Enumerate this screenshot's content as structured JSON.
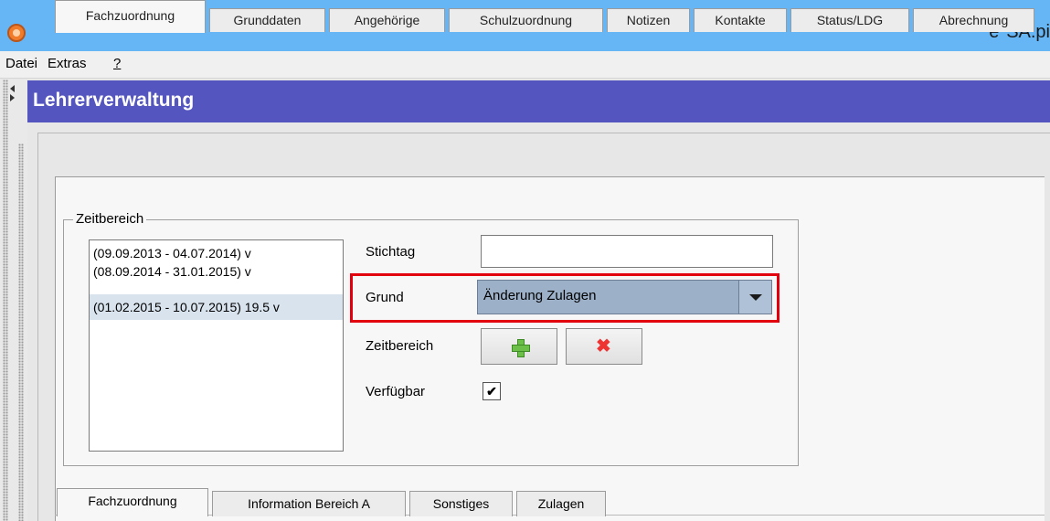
{
  "window": {
    "title": "e*SA.pi"
  },
  "menu": {
    "items": [
      "Datei",
      "Extras",
      "?"
    ]
  },
  "header": {
    "title": "Lehrerverwaltung"
  },
  "tabs": [
    "Fachzuordnung",
    "Grunddaten",
    "Angehörige",
    "Schulzuordnung",
    "Notizen",
    "Kontakte",
    "Status/LDG",
    "Abrechnung"
  ],
  "active_tab": "Fachzuordnung",
  "zeitbereich": {
    "legend": "Zeitbereich",
    "list": [
      "(09.09.2013 - 04.07.2014) v",
      "(08.09.2014 - 31.01.2015) v",
      "(01.02.2015 - 10.07.2015) 19.5 v"
    ],
    "selected_index": 2
  },
  "form": {
    "stichtag_label": "Stichtag",
    "stichtag_value": "",
    "grund_label": "Grund",
    "grund_value": "Änderung Zulagen",
    "zeitbereich_label": "Zeitbereich",
    "verfuegbar_label": "Verfügbar",
    "verfuegbar_checked": "✔"
  },
  "bottom_tabs": [
    "Fachzuordnung",
    "Information Bereich A",
    "Sonstiges",
    "Zulagen"
  ],
  "colors": {
    "header": "#5555bf",
    "titlebar": "#66b5f5",
    "highlight": "#e2000f",
    "combo": "#9cb0c8"
  },
  "icons": {
    "add": "plus-icon",
    "remove": "x-icon",
    "dropdown": "chevron-down-icon"
  }
}
